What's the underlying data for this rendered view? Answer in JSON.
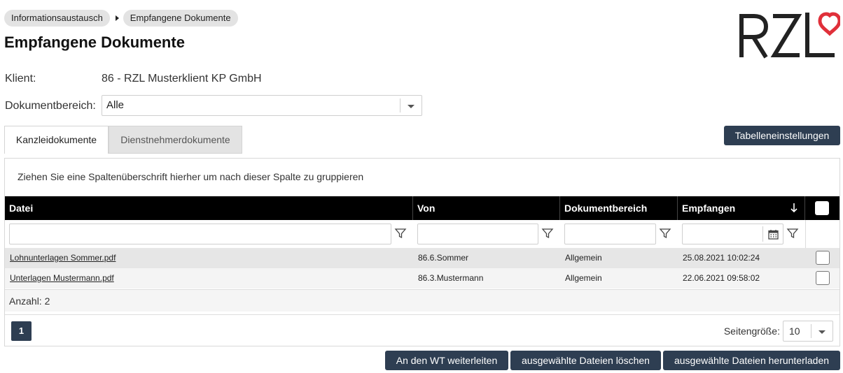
{
  "breadcrumb": {
    "items": [
      "Informationsaustausch",
      "Empfangene Dokumente"
    ]
  },
  "page": {
    "title": "Empfangene Dokumente",
    "brand": "RZL",
    "brand_color": "#e0303a"
  },
  "client": {
    "label": "Klient:",
    "value": "86 - RZL Musterklient KP GmbH"
  },
  "dokumentbereich": {
    "label": "Dokumentbereich:",
    "selected": "Alle"
  },
  "tabs": [
    {
      "label": "Kanzleidokumente",
      "active": true
    },
    {
      "label": "Dienstnehmerdokumente",
      "active": false
    }
  ],
  "buttons": {
    "table_settings": "Tabelleneinstellungen",
    "forward": "An den WT weiterleiten",
    "delete": "ausgewählte Dateien löschen",
    "download": "ausgewählte Dateien herunterladen"
  },
  "grid": {
    "group_hint": "Ziehen Sie eine Spaltenüberschrift hierher um nach dieser Spalte zu gruppieren",
    "columns": [
      "Datei",
      "Von",
      "Dokumentbereich",
      "Empfangen"
    ],
    "sort_icon": "arrow-down-icon",
    "rows": [
      {
        "datei": "Lohnunterlagen Sommer.pdf",
        "von": "86.6.Sommer",
        "bereich": "Allgemein",
        "empfangen": "25.08.2021 10:02:24"
      },
      {
        "datei": "Unterlagen Mustermann.pdf",
        "von": "86.3.Mustermann",
        "bereich": "Allgemein",
        "empfangen": "22.06.2021 09:58:02"
      }
    ],
    "count": "Anzahl: 2",
    "current_page": "1",
    "page_size_label": "Seitengröße:",
    "page_size": "10"
  },
  "colors": {
    "header_bg": "#000000",
    "button_bg": "#2e3e52",
    "row_selected_bg": "#e6e6e6",
    "row_bg": "#f4f4f4"
  }
}
